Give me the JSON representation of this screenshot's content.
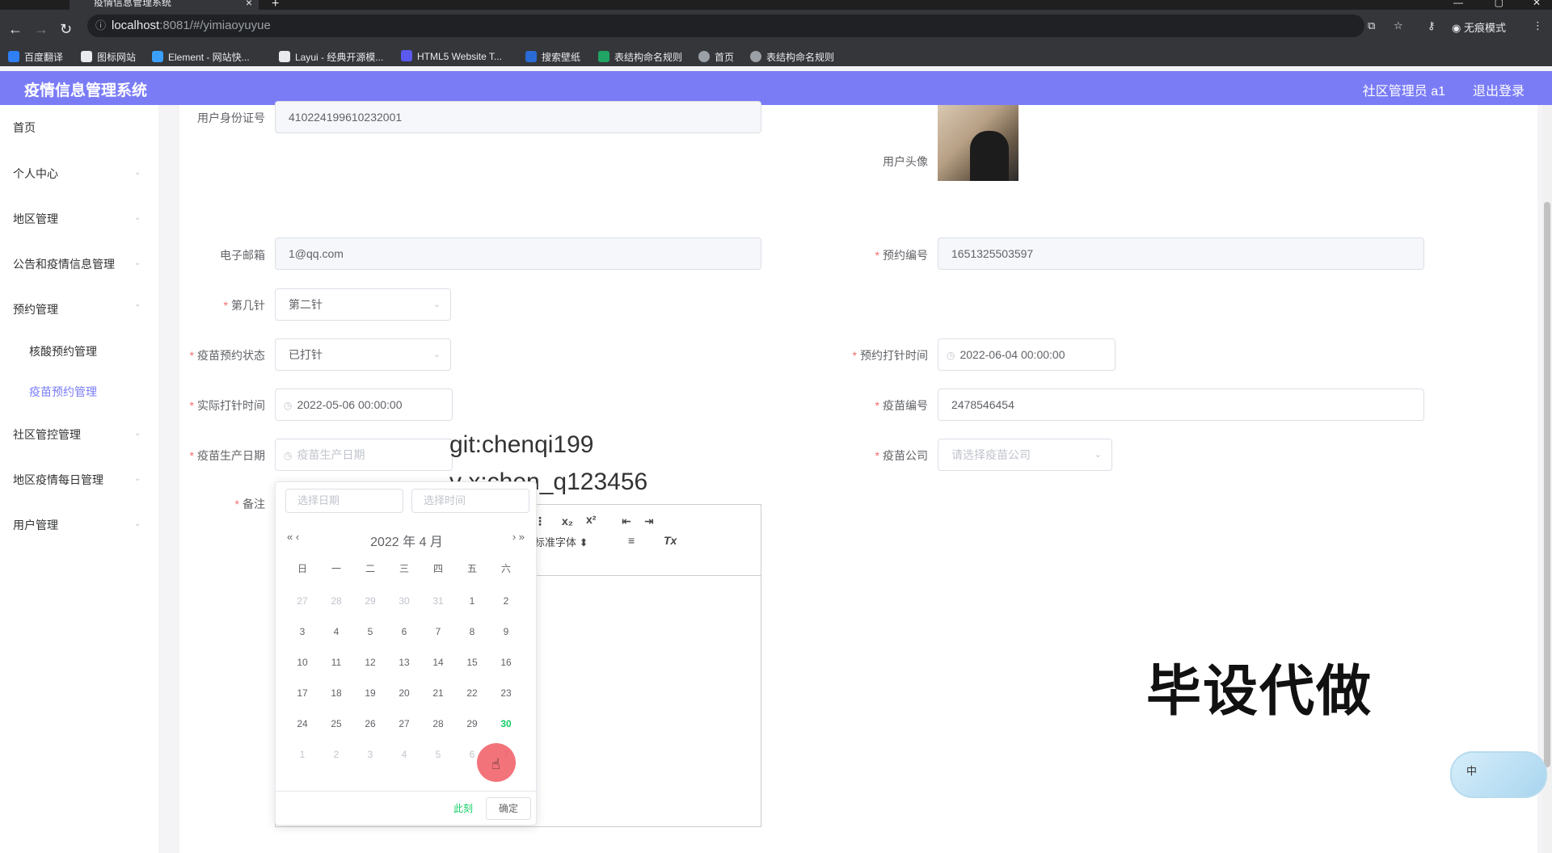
{
  "browser": {
    "tab_title": "疫情信息管理系统",
    "tab_close": "×",
    "new_tab": "+",
    "url_host": "localhost",
    "url_rest": ":8081/#/yimiaoyuyue",
    "profile_label": "无痕模式",
    "bookmarks": [
      {
        "label": "百度翻译",
        "color": "#2f7ff5"
      },
      {
        "label": "图标网站",
        "color": "#111111"
      },
      {
        "label": "Element - 网站快...",
        "color": "#3aa0ff"
      },
      {
        "label": "Layui - 经典开源模...",
        "color": "#111111"
      },
      {
        "label": "HTML5 Website T...",
        "color": "#5a5af0"
      },
      {
        "label": "搜索壁纸",
        "color": "#2a6bd6"
      },
      {
        "label": "表结构命名规则",
        "color": "#1fa463"
      },
      {
        "label": "首页",
        "color": "#9aa0a6"
      },
      {
        "label": "表结构命名规则",
        "color": "#9aa0a6"
      }
    ]
  },
  "header": {
    "title": "疫情信息管理系统",
    "user": "社区管理员 a1",
    "logout": "退出登录"
  },
  "sidebar": {
    "items": [
      {
        "label": "首页"
      },
      {
        "label": "个人中心"
      },
      {
        "label": "地区管理"
      },
      {
        "label": "公告和疫情信息管理"
      },
      {
        "label": "预约管理"
      },
      {
        "label": "核酸预约管理"
      },
      {
        "label": "疫苗预约管理"
      },
      {
        "label": "社区管控管理"
      },
      {
        "label": "地区疫情每日管理"
      },
      {
        "label": "用户管理"
      }
    ]
  },
  "form": {
    "id_card": {
      "label": "用户身份证号",
      "value": "410224199610232001"
    },
    "avatar": {
      "label": "用户头像"
    },
    "email": {
      "label": "电子邮箱",
      "value": "1@qq.com"
    },
    "booking_no": {
      "label": "预约编号",
      "value": "1651325503597"
    },
    "dose": {
      "label": "第几针",
      "value": "第二针"
    },
    "status": {
      "label": "疫苗预约状态",
      "value": "已打针"
    },
    "scheduled_time": {
      "label": "预约打针时间",
      "value": "2022-06-04 00:00:00"
    },
    "actual_time": {
      "label": "实际打针时间",
      "value": "2022-05-06 00:00:00"
    },
    "vaccine_no": {
      "label": "疫苗编号",
      "value": "2478546454"
    },
    "production_date": {
      "label": "疫苗生产日期",
      "placeholder": "疫苗生产日期"
    },
    "company": {
      "label": "疫苗公司",
      "placeholder": "请选择疫苗公司"
    },
    "remark": {
      "label": "备注"
    }
  },
  "editor": {
    "sub": "x₂",
    "sup": "x²",
    "font": "标准字体",
    "clear": "Tx"
  },
  "watermarks": {
    "line1": "git:chenqi199",
    "line2": "v x:chen_q123456",
    "big": "毕设代做"
  },
  "datepicker": {
    "date_placeholder": "选择日期",
    "time_placeholder": "选择时间",
    "header": "2022 年  4 月",
    "weekdays": [
      "日",
      "一",
      "二",
      "三",
      "四",
      "五",
      "六"
    ],
    "rows": [
      [
        "27",
        "28",
        "29",
        "30",
        "31",
        "1",
        "2"
      ],
      [
        "3",
        "4",
        "5",
        "6",
        "7",
        "8",
        "9"
      ],
      [
        "10",
        "11",
        "12",
        "13",
        "14",
        "15",
        "16"
      ],
      [
        "17",
        "18",
        "19",
        "20",
        "21",
        "22",
        "23"
      ],
      [
        "24",
        "25",
        "26",
        "27",
        "28",
        "29",
        "30"
      ],
      [
        "1",
        "2",
        "3",
        "4",
        "5",
        "6",
        "7"
      ]
    ],
    "today": "30",
    "now_btn": "此刻",
    "ok_btn": "确定"
  },
  "float_widget": {
    "label": "中"
  }
}
